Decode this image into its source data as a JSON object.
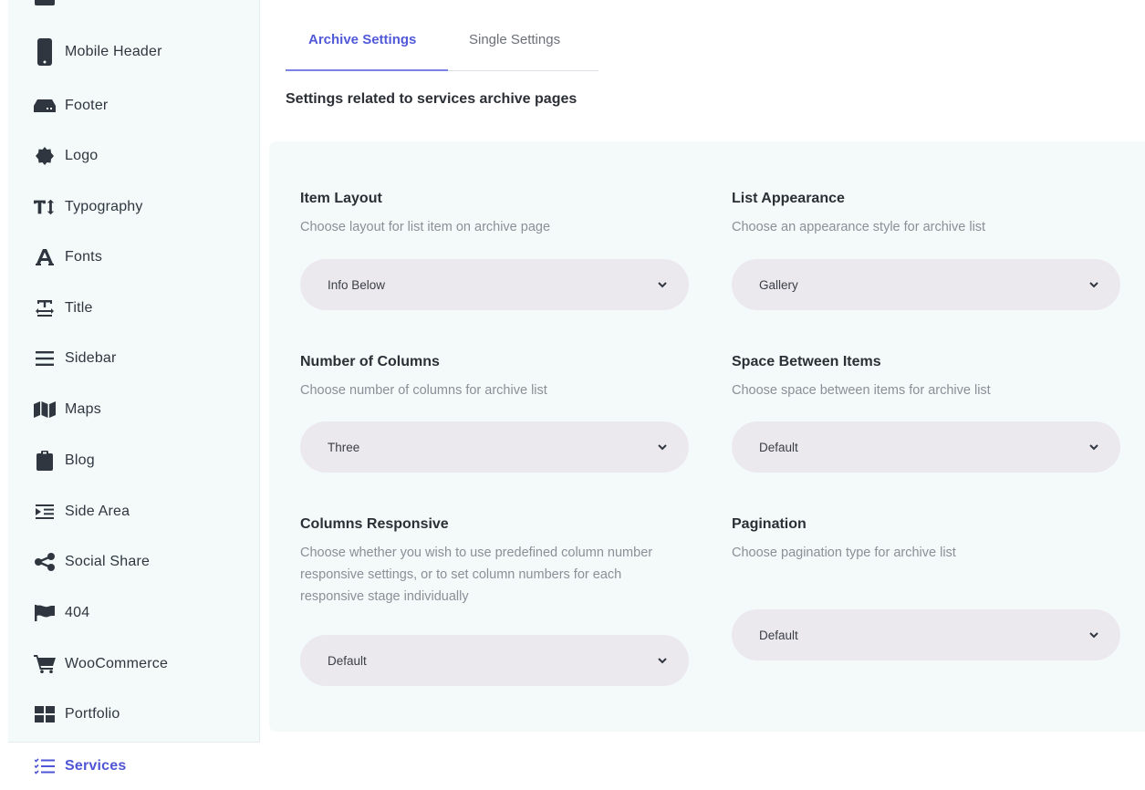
{
  "sidebar": {
    "items": [
      {
        "label": "Mobile Header",
        "icon": "mobile-phone-icon"
      },
      {
        "label": "Footer",
        "icon": "footer-icon"
      },
      {
        "label": "Logo",
        "icon": "logo-badge-icon"
      },
      {
        "label": "Typography",
        "icon": "text-height-icon"
      },
      {
        "label": "Fonts",
        "icon": "font-icon"
      },
      {
        "label": "Title",
        "icon": "title-icon"
      },
      {
        "label": "Sidebar",
        "icon": "menu-lines-icon"
      },
      {
        "label": "Maps",
        "icon": "map-icon"
      },
      {
        "label": "Blog",
        "icon": "clipboard-icon"
      },
      {
        "label": "Side Area",
        "icon": "side-area-icon"
      },
      {
        "label": "Social Share",
        "icon": "share-icon"
      },
      {
        "label": "404",
        "icon": "flag-icon"
      },
      {
        "label": "WooCommerce",
        "icon": "cart-icon"
      },
      {
        "label": "Portfolio",
        "icon": "grid-icon"
      },
      {
        "label": "Services",
        "icon": "checklist-icon"
      }
    ],
    "active": "Services"
  },
  "tabs": {
    "archive": "Archive Settings",
    "single": "Single Settings"
  },
  "section_description": "Settings related to services archive pages",
  "fields": {
    "item_layout": {
      "title": "Item Layout",
      "help": "Choose layout for list item on archive page",
      "value": "Info Below"
    },
    "list_appearance": {
      "title": "List Appearance",
      "help": "Choose an appearance style for archive list",
      "value": "Gallery"
    },
    "number_of_columns": {
      "title": "Number of Columns",
      "help": "Choose number of columns for archive list",
      "value": "Three"
    },
    "space_between_items": {
      "title": "Space Between Items",
      "help": "Choose space between items for archive list",
      "value": "Default"
    },
    "columns_responsive": {
      "title": "Columns Responsive",
      "help": "Choose whether you wish to use predefined column number responsive settings, or to set column numbers for each responsive stage individually",
      "value": "Default"
    },
    "pagination": {
      "title": "Pagination",
      "help": "Choose pagination type for archive list",
      "value": "Default"
    }
  },
  "colors": {
    "accent": "#5159d8",
    "panel_bg": "#f4faf9",
    "select_bg": "#ece9ee",
    "icon": "#2f3640"
  }
}
